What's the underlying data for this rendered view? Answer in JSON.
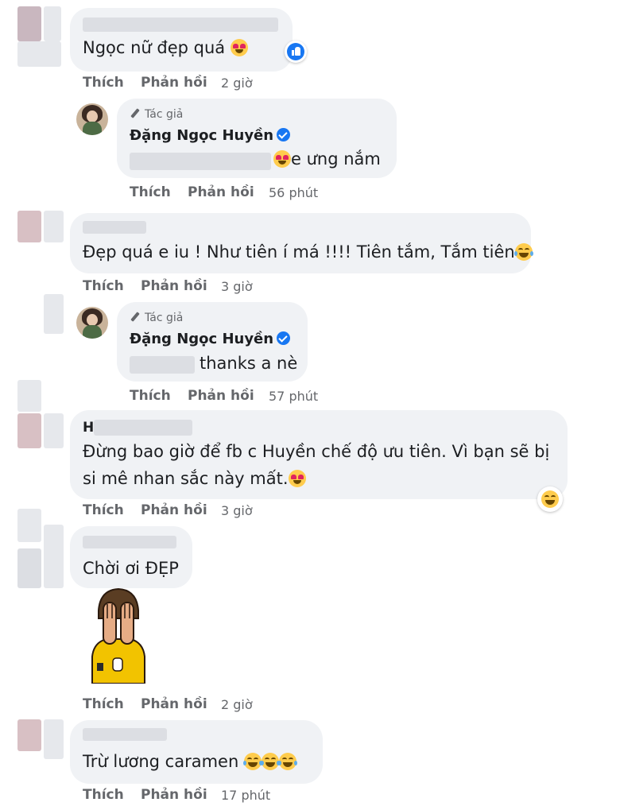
{
  "actions": {
    "like": "Thích",
    "reply": "Phản hồi"
  },
  "author_tag": "Tác giả",
  "author_name": "Đặng Ngọc Huyền",
  "comments": [
    {
      "text": "Ngọc nữ đẹp quá",
      "time": "2 giờ"
    },
    {
      "text_suffix": "e ưng nắm",
      "time": "56 phút"
    },
    {
      "text": "Đẹp quá e iu ! Như tiên í má !!!! Tiên tắm, Tắm tiên",
      "time": "3 giờ"
    },
    {
      "text": "thanks a nè",
      "time": "57 phút"
    },
    {
      "line1": "Đừng bao giờ để fb c Huyền chế độ ưu tiên. Vì bạn sẽ bị",
      "line2": "si mê nhan sắc này mất.",
      "time": "3 giờ",
      "name_initial": "H"
    },
    {
      "text": "Chời ơi ĐẸP",
      "time": "2 giờ"
    },
    {
      "text": "Trừ lương caramen",
      "time": "17 phút"
    }
  ],
  "colors": {
    "bubble": "#f0f2f5",
    "muted": "#65676b",
    "verified": "#1877f2",
    "text": "#1c1e21"
  },
  "icons": [
    "like-icon",
    "heart-eyes-emoji",
    "tears-of-joy-emoji",
    "laughing-emoji",
    "verified-icon",
    "pen-icon",
    "facepalm-sticker"
  ]
}
